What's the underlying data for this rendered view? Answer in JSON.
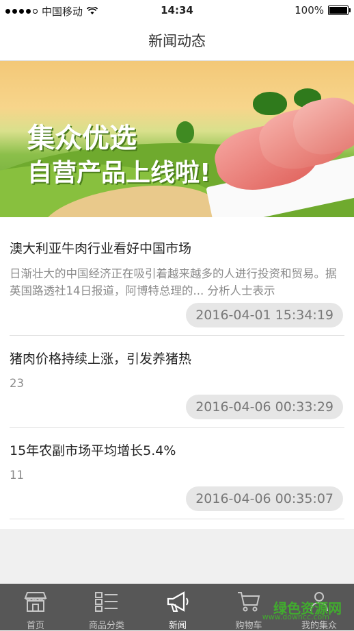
{
  "status_bar": {
    "carrier": "中国移动",
    "time": "14:34",
    "battery": "100%"
  },
  "nav": {
    "title": "新闻动态"
  },
  "banner": {
    "line1": "集众优选",
    "line2": "自营产品上线啦!"
  },
  "news": [
    {
      "title": "澳大利亚牛肉行业看好中国市场",
      "desc": "日渐壮大的中国经济正在吸引着越来越多的人进行投资和贸易。据英国路透社14日报道，阿博特总理的... 分析人士表示",
      "time": "2016-04-01 15:34:19"
    },
    {
      "title": "猪肉价格持续上涨，引发养猪热",
      "desc": "23",
      "time": "2016-04-06 00:33:29"
    },
    {
      "title": "15年农副市场平均增长5.4%",
      "desc": "11",
      "time": "2016-04-06 00:35:07"
    }
  ],
  "tabs": [
    {
      "label": "首页",
      "icon": "store-icon"
    },
    {
      "label": "商品分类",
      "icon": "list-icon"
    },
    {
      "label": "新闻",
      "icon": "megaphone-icon"
    },
    {
      "label": "购物车",
      "icon": "cart-icon"
    },
    {
      "label": "我的集众",
      "icon": "user-icon"
    }
  ],
  "watermark": {
    "text": "绿色资源网",
    "url": "www.downcc.com"
  }
}
